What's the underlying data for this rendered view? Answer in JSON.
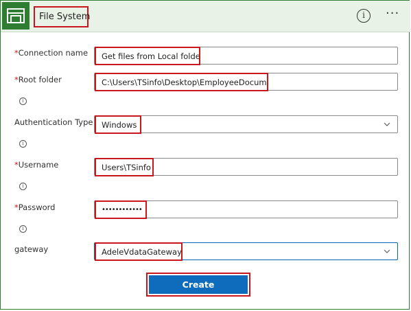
{
  "header": {
    "title": "File System",
    "icon": "folder-connector-icon",
    "info_glyph": "i",
    "more_glyph": "···"
  },
  "form": {
    "connection_name": {
      "label": "Connection name",
      "required_mark": "*",
      "value": "Get files from Local folder"
    },
    "root_folder": {
      "label": "Root folder",
      "required_mark": "*",
      "value": "C:\\Users\\TSinfo\\Desktop\\EmployeeDocumets"
    },
    "authentication_type": {
      "label": "Authentication Type",
      "value": "Windows"
    },
    "username": {
      "label": "Username",
      "required_mark": "*",
      "value": "Users\\TSinfo"
    },
    "password": {
      "label": "Password",
      "required_mark": "*",
      "value": "••••••••••••"
    },
    "gateway": {
      "label": "gateway",
      "value": "AdeleVdataGateway"
    },
    "info_glyph": "i"
  },
  "actions": {
    "create_label": "Create"
  },
  "colors": {
    "brand_green": "#2e7d32",
    "header_bg": "#e9f2e6",
    "highlight_red": "#c8161d",
    "primary_blue": "#0f6cbd"
  }
}
